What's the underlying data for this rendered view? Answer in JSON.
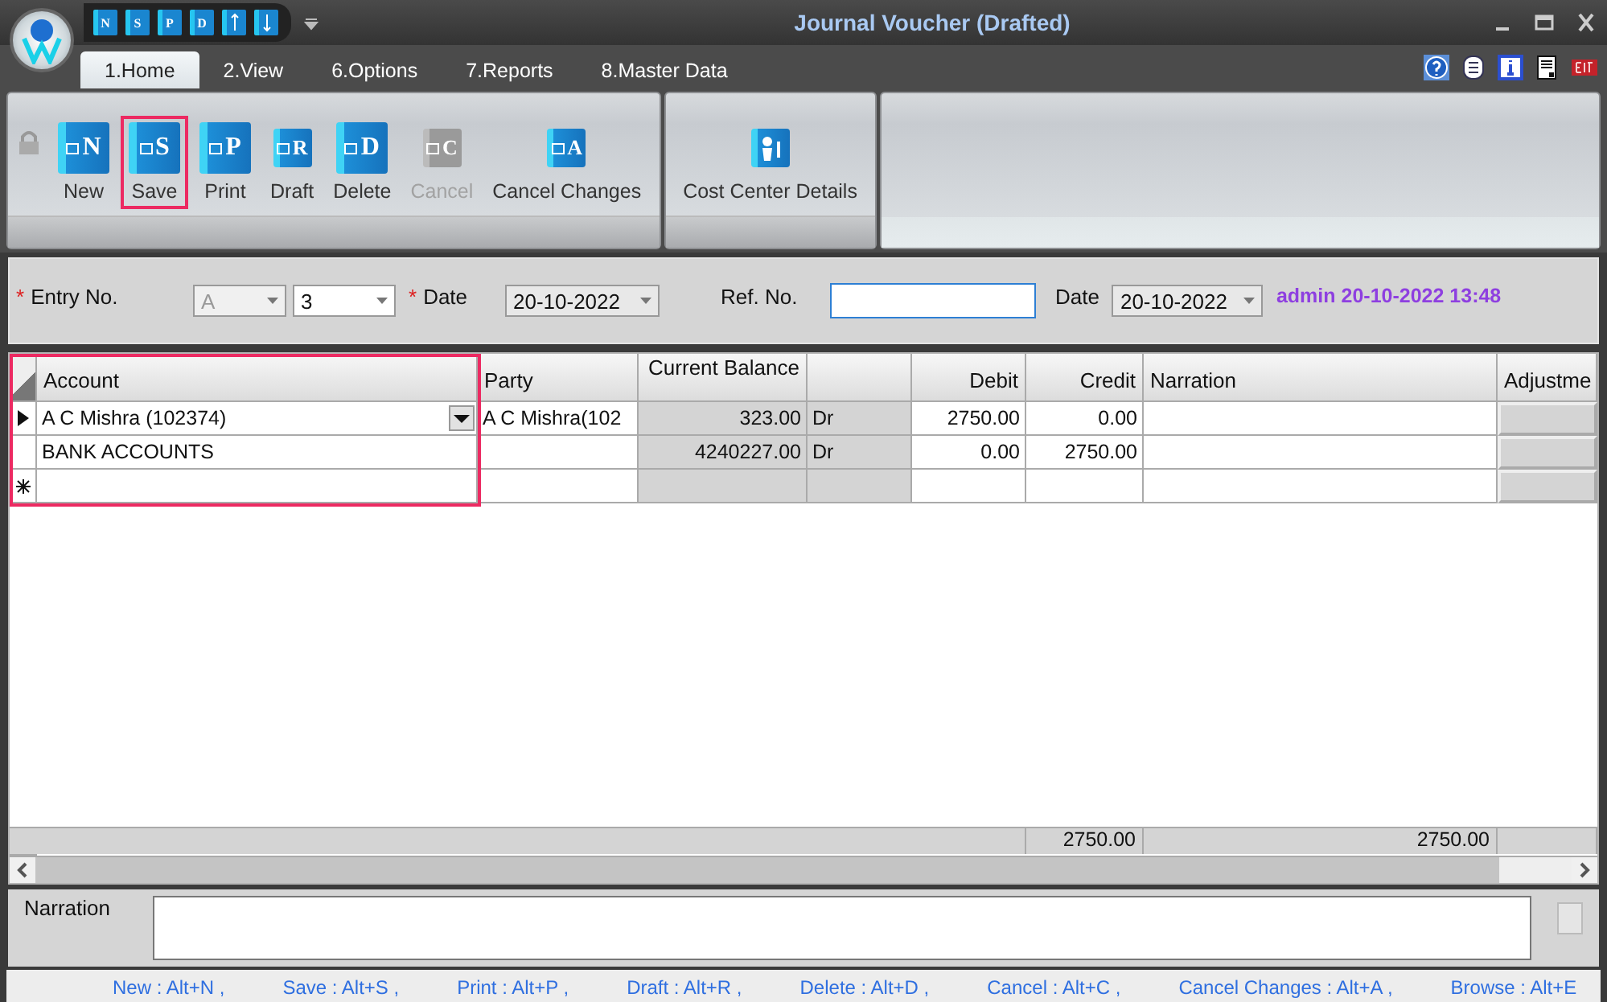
{
  "window": {
    "title": "Journal Voucher (Drafted)"
  },
  "quick_access": [
    {
      "kind": "letter",
      "glyph": "N"
    },
    {
      "kind": "letter",
      "glyph": "S"
    },
    {
      "kind": "letter",
      "glyph": "P"
    },
    {
      "kind": "letter",
      "glyph": "D"
    },
    {
      "kind": "arrow_up"
    },
    {
      "kind": "arrow_down"
    }
  ],
  "tabs": [
    {
      "label": "1.Home",
      "selected": true
    },
    {
      "label": "2.View",
      "selected": false
    },
    {
      "label": "6.Options",
      "selected": false
    },
    {
      "label": "7.Reports",
      "selected": false
    },
    {
      "label": "8.Master Data",
      "selected": false
    }
  ],
  "ribbon": {
    "groups": [
      {
        "lock": true,
        "buttons": [
          {
            "label": "New",
            "glyph": "N",
            "kind": "large",
            "disabled": false,
            "highlighted": false
          },
          {
            "label": "Save",
            "glyph": "S",
            "kind": "large",
            "disabled": false,
            "highlighted": true
          },
          {
            "label": "Print",
            "glyph": "P",
            "kind": "large",
            "disabled": false,
            "highlighted": false
          },
          {
            "label": "Draft",
            "glyph": "R",
            "kind": "small",
            "disabled": false,
            "highlighted": false
          },
          {
            "label": "Delete",
            "glyph": "D",
            "kind": "large",
            "disabled": false,
            "highlighted": false
          },
          {
            "label": "Cancel",
            "glyph": "C",
            "kind": "small",
            "disabled": true,
            "highlighted": false
          },
          {
            "label": "Cancel Changes",
            "glyph": "A",
            "kind": "small",
            "disabled": false,
            "highlighted": false
          }
        ]
      },
      {
        "lock": false,
        "buttons": [
          {
            "label": "Cost Center Details",
            "kind": "small",
            "disabled": false,
            "highlighted": false
          }
        ]
      }
    ]
  },
  "form": {
    "entry_mark": "*",
    "entry_label": "Entry No.",
    "series": "A",
    "series_disabled": true,
    "number": "3",
    "date_mark": "*",
    "date_label": "Date",
    "date": "20-10-2022",
    "ref_label": "Ref. No.",
    "ref_date_label": "Date",
    "ref_date": "20-10-2022",
    "audit": "admin 20-10-2022 13:48"
  },
  "grid": {
    "columns": [
      {
        "label": "Account",
        "kind": "text",
        "highlighted": true
      },
      {
        "label": "Party",
        "kind": "text",
        "highlighted": false
      },
      {
        "label": "Current Balance",
        "kind": "amount",
        "highlighted": false
      },
      {
        "kind": "text",
        "highlighted": false
      },
      {
        "label": "Debit",
        "kind": "amount",
        "highlighted": false
      },
      {
        "label": "Credit",
        "kind": "amount",
        "highlighted": false
      },
      {
        "label": "Narration",
        "kind": "text",
        "highlighted": false
      },
      {
        "label": "Adjustme",
        "kind": "text",
        "highlighted": false
      }
    ],
    "rows": [
      {
        "current": true,
        "new": false,
        "cells": [
          "A C Mishra (102374)",
          "A C Mishra(102",
          "323.00",
          "Dr",
          "2750.00",
          "0.00",
          ""
        ]
      },
      {
        "current": false,
        "new": false,
        "cells": [
          "BANK ACCOUNTS",
          "",
          "4240227.00",
          "Dr",
          "0.00",
          "2750.00",
          ""
        ]
      },
      {
        "current": false,
        "new": true,
        "cells": [
          "",
          "",
          "",
          "",
          "",
          "",
          ""
        ]
      }
    ],
    "totals": {
      "debit": "2750.00",
      "credit": "2750.00"
    }
  },
  "narration": {
    "label": "Narration"
  },
  "shortcuts": [
    "New : Alt+N ,",
    "Save : Alt+S ,",
    "Print : Alt+P ,",
    "Draft : Alt+R ,",
    "Delete : Alt+D ,",
    "Cancel : Alt+C ,",
    "Cancel Changes : Alt+A ,",
    "Browse : Alt+E"
  ]
}
